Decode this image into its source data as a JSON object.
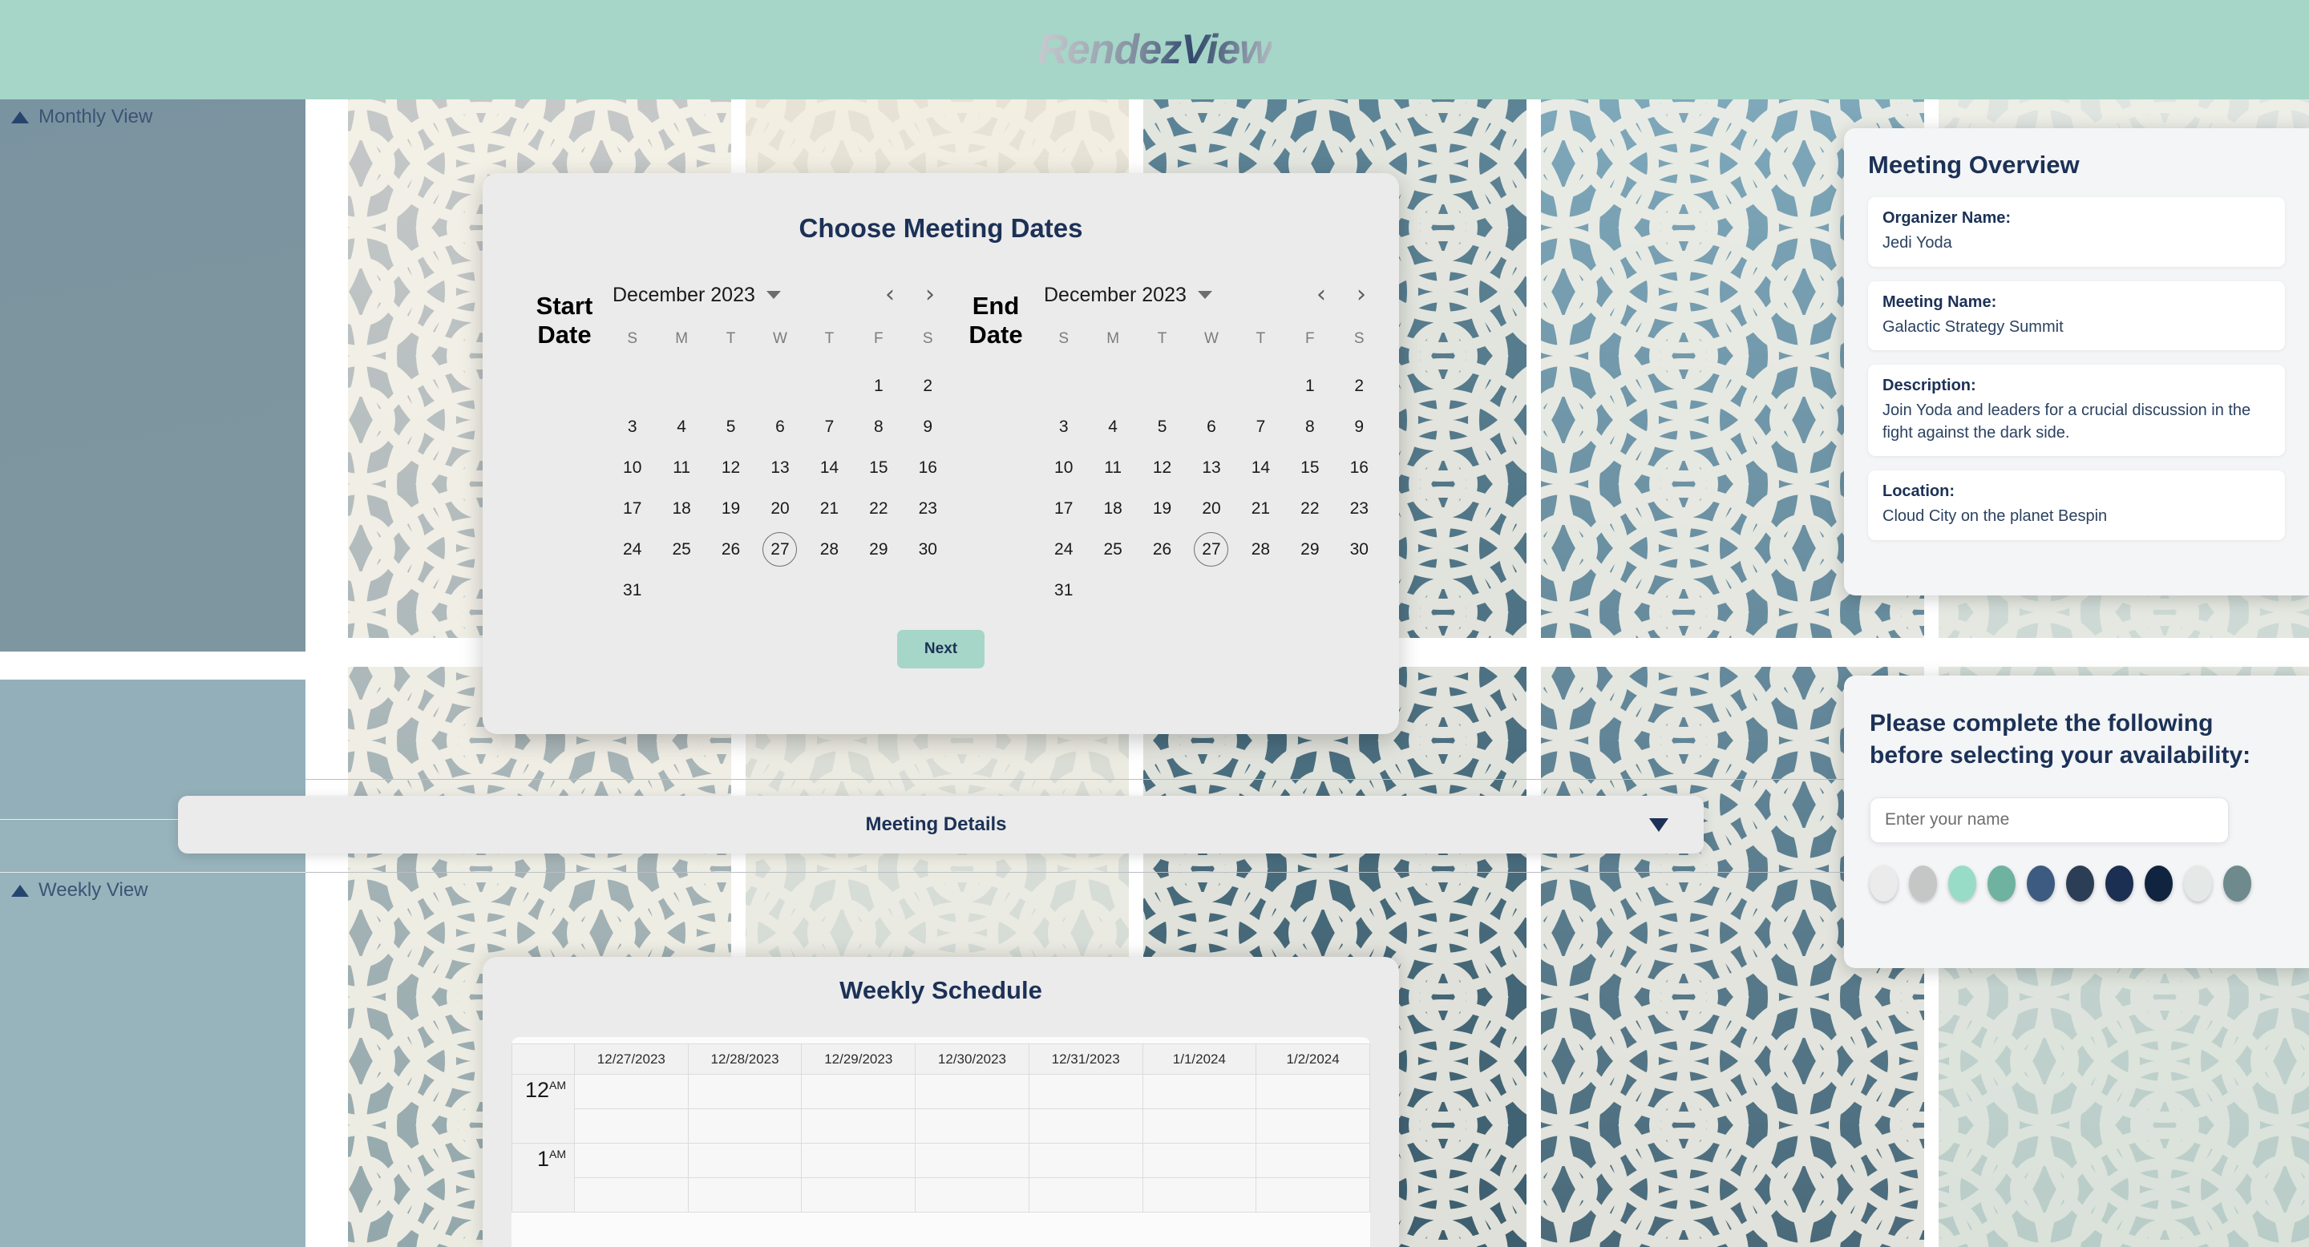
{
  "app": {
    "brand": "RendezView",
    "header_color": "#a5d6c8"
  },
  "sidebar": {
    "monthly_view_label": "Monthly View",
    "weekly_view_label": "Weekly View"
  },
  "date_dialog": {
    "title": "Choose Meeting Dates",
    "start_label": "Start Date",
    "end_label": "End Date",
    "next_button": "Next",
    "dow": [
      "S",
      "M",
      "T",
      "W",
      "T",
      "F",
      "S"
    ],
    "start_calendar": {
      "month_label": "December 2023",
      "lead_blanks": 5,
      "days_in_month": 31,
      "today": 27
    },
    "end_calendar": {
      "month_label": "December 2023",
      "lead_blanks": 5,
      "days_in_month": 31,
      "today": 27
    }
  },
  "meeting_details": {
    "label": "Meeting Details",
    "expanded": false
  },
  "weekly": {
    "title": "Weekly Schedule",
    "day_columns": [
      "12/27/2023",
      "12/28/2023",
      "12/29/2023",
      "12/30/2023",
      "12/31/2023",
      "1/1/2024",
      "1/2/2024"
    ],
    "time_rows": [
      {
        "hour": "12",
        "period": "AM"
      },
      {
        "hour": "1",
        "period": "AM"
      }
    ]
  },
  "overview": {
    "title": "Meeting Overview",
    "items": [
      {
        "key": "Organizer Name:",
        "value": "Jedi Yoda"
      },
      {
        "key": "Meeting Name:",
        "value": "Galactic Strategy Summit"
      },
      {
        "key": "Description:",
        "value": "Join Yoda and leaders for a crucial discussion in the fight against the dark side."
      },
      {
        "key": "Location:",
        "value": "Cloud City on the planet Bespin"
      }
    ]
  },
  "availability": {
    "title": "Please complete the following before selecting your availability:",
    "name_input_value": "",
    "name_input_placeholder": "Enter your name",
    "swatches": [
      "#ebebeb",
      "#c5c7c6",
      "#98dcc8",
      "#70b2a0",
      "#3d5b81",
      "#2c3e56",
      "#1b2f52",
      "#11243f",
      "#e4e9e7",
      "#6e8a8c"
    ]
  },
  "background": {
    "palette": [
      "#b3b5b5",
      "#6b8694",
      "#4a6a7a",
      "#9fc4c4",
      "#7fa8bb",
      "#f2eee3",
      "#cfd8d4",
      "#5a8297",
      "#aac9cd",
      "#e9e3d6"
    ]
  }
}
